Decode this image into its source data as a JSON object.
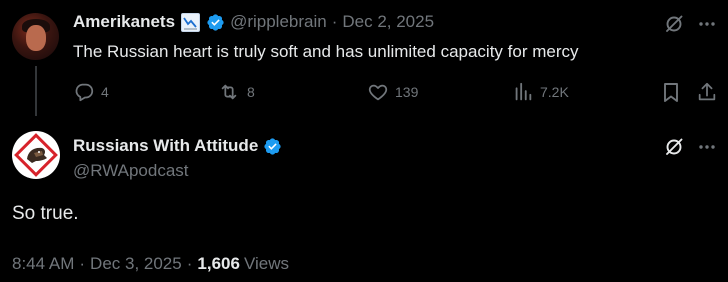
{
  "reply": {
    "author_name": "Amerikanets",
    "handle": "@ripplebrain",
    "separator": "·",
    "date": "Dec 2, 2025",
    "text": "The Russian heart is truly soft and has unlimited capacity for mercy",
    "actions": {
      "replies": "4",
      "reposts": "8",
      "likes": "139",
      "views": "7.2K"
    }
  },
  "main": {
    "author_name": "Russians With Attitude",
    "handle": "@RWApodcast",
    "text": "So true.",
    "time": "8:44 AM",
    "date": "Dec 3, 2025",
    "views_count": "1,606",
    "views_label": "Views",
    "separator": "·"
  },
  "colors": {
    "background": "#000000",
    "text": "#e7e9ea",
    "muted": "#71767b",
    "verified": "#1d9bf0",
    "logo_red": "#d7232b"
  },
  "icons": [
    "grok-icon",
    "more-icon",
    "reply-icon",
    "repost-icon",
    "like-icon",
    "views-icon",
    "bookmark-icon",
    "share-icon",
    "verified-badge-icon",
    "chart-emoji-icon"
  ]
}
